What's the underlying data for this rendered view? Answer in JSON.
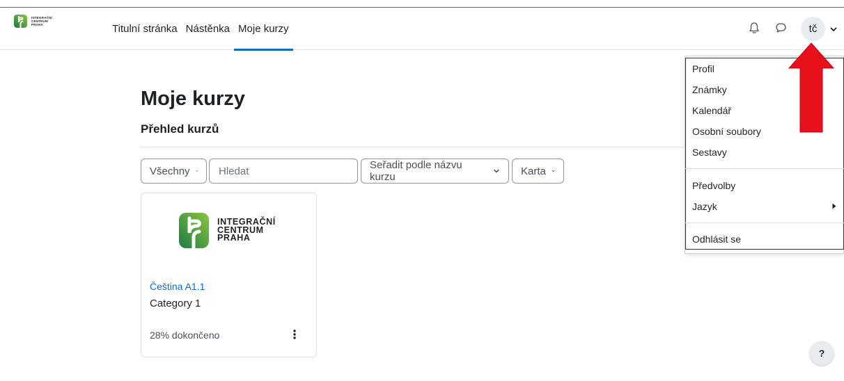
{
  "brand": {
    "lines": [
      "INTEGRAČNÍ",
      "CENTRUM",
      "PRAHA"
    ],
    "colors": {
      "green_dark": "#1e7a44",
      "green_light": "#8cc63f"
    }
  },
  "nav": {
    "items": [
      {
        "label": "Titulní stránka",
        "active": false
      },
      {
        "label": "Nástěnka",
        "active": false
      },
      {
        "label": "Moje kurzy",
        "active": true
      }
    ],
    "accent": "#0f6cbf"
  },
  "user": {
    "initials": "tč",
    "icons": [
      "bell-icon",
      "chat-icon",
      "chevron-down-icon"
    ]
  },
  "page": {
    "title": "Moje kurzy",
    "block_title": "Přehled kurzů"
  },
  "controls": {
    "filter": "Všechny",
    "search_placeholder": "Hledat",
    "sort": "Seřadit podle názvu kurzu",
    "view": "Karta"
  },
  "course": {
    "name": "Čeština A1.1",
    "category": "Category 1",
    "progress_text": "28% dokončeno",
    "progress": 0.28,
    "logo_lines": [
      "INTEGRAČNÍ",
      "CENTRUM",
      "PRAHA"
    ]
  },
  "user_menu": {
    "groups": [
      [
        "Profil",
        "Známky",
        "Kalendář",
        "Osobní soubory",
        "Sestavy"
      ],
      [
        "Předvolby",
        "Jazyk"
      ],
      [
        "Odhlásit se"
      ]
    ]
  },
  "annotation": {
    "color": "#e8101a"
  },
  "help": {
    "label": "?"
  }
}
